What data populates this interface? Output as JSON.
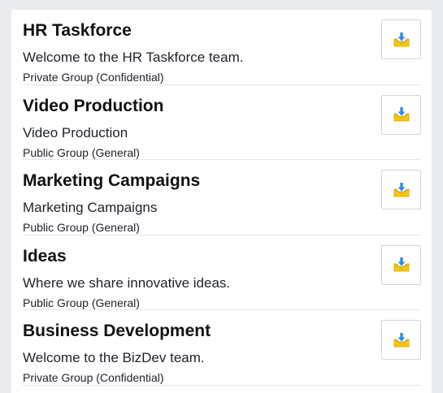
{
  "groups": [
    {
      "name": "HR Taskforce",
      "description": "Welcome to the HR Taskforce team.",
      "privacy": "Private Group (Confidential)",
      "action_icon": "join-inbox-icon"
    },
    {
      "name": "Video Production",
      "description": "Video Production",
      "privacy": "Public Group (General)",
      "action_icon": "join-inbox-icon"
    },
    {
      "name": "Marketing Campaigns",
      "description": "Marketing Campaigns",
      "privacy": "Public Group (General)",
      "action_icon": "join-inbox-icon"
    },
    {
      "name": "Ideas",
      "description": "Where we share innovative ideas.",
      "privacy": "Public Group (General)",
      "action_icon": "join-inbox-icon"
    },
    {
      "name": "Business Development",
      "description": "Welcome to the BizDev team.",
      "privacy": "Private Group (Confidential)",
      "action_icon": "join-inbox-icon"
    }
  ],
  "colors": {
    "background": "#e9ebee",
    "icon_tray": "#f5c518",
    "icon_arrow": "#2b8be0"
  }
}
